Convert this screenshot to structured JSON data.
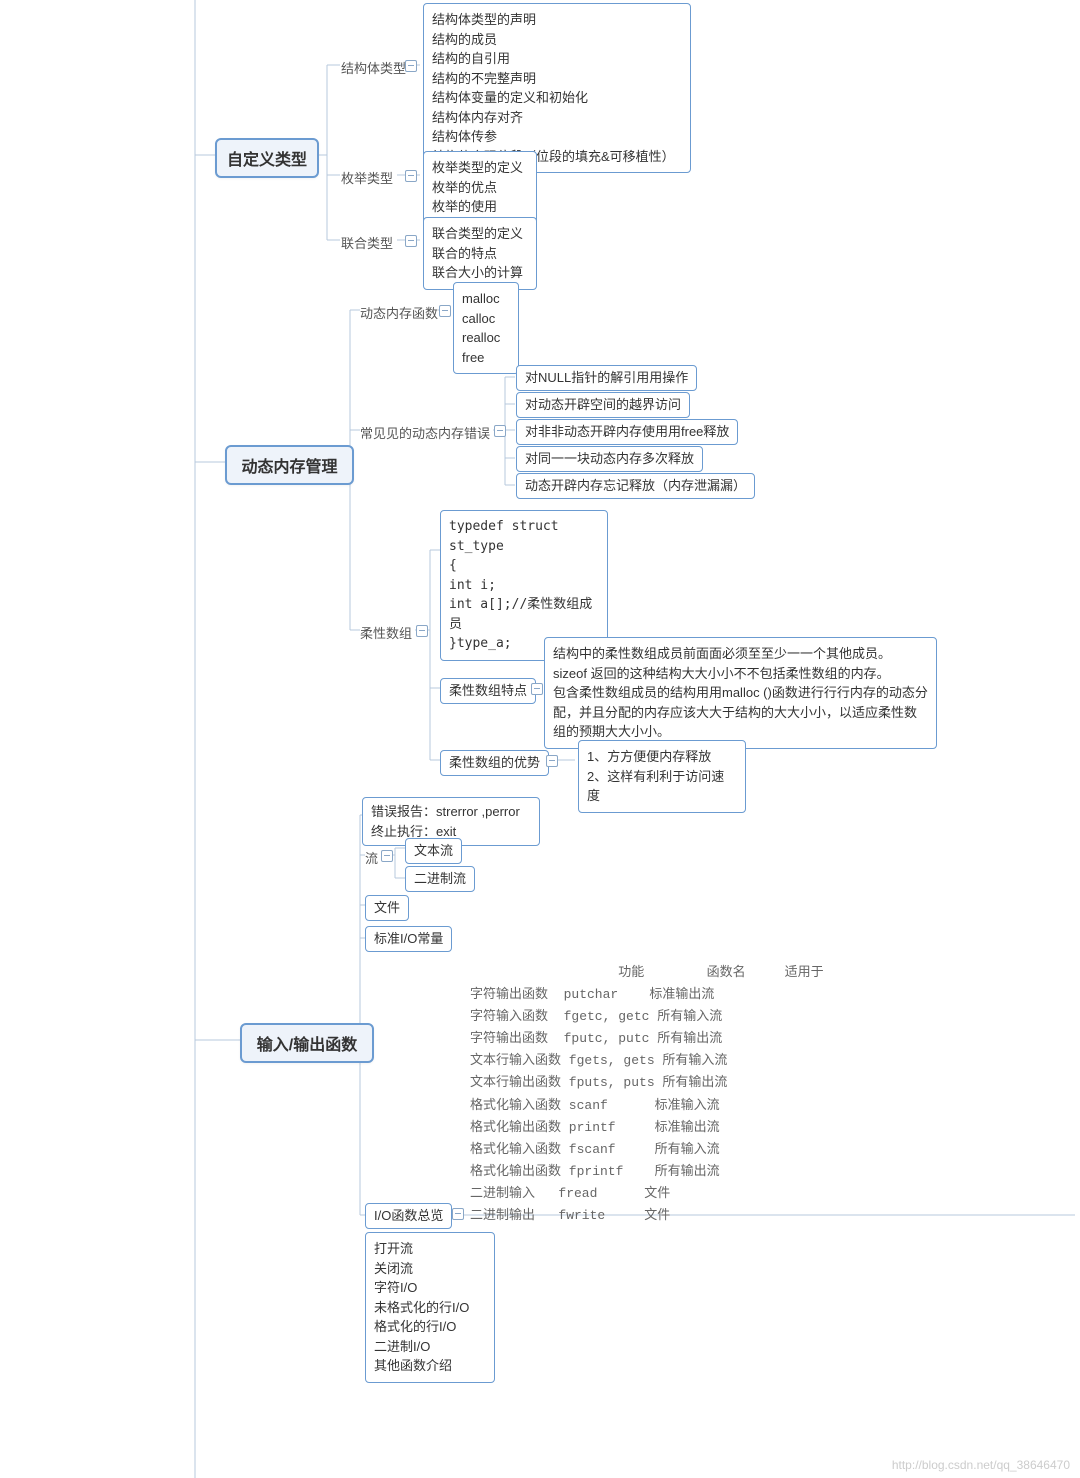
{
  "watermark": "http://blog.csdn.net/qq_38646470",
  "root1": {
    "label": "自定义类型"
  },
  "r1_struct": {
    "label": "结构体类型",
    "items": "结构体类型的声明\n结构的成员\n结构的自引用\n结构的不完整声明\n结构体变量的定义和初始化\n结构体内存对齐\n结构体传参\n结构体实现位段（位段的填充&可移植性）"
  },
  "r1_enum": {
    "label": "枚举类型",
    "items": "枚举类型的定义\n枚举的优点\n枚举的使用"
  },
  "r1_union": {
    "label": "联合类型",
    "items": "联合类型的定义\n联合的特点\n联合大小的计算"
  },
  "root2": {
    "label": "动态内存管理"
  },
  "r2_funcs": {
    "label": "动态内存函数",
    "items": "malloc\ncalloc\nrealloc\nfree"
  },
  "r2_errors": {
    "label": "常见见的动态内存错误",
    "e1": "对NULL指针的解引用用操作",
    "e2": "对动态开辟空间的越界访问",
    "e3": "对非非动态开辟内存使用用free释放",
    "e4": "对同一一块动态内存多次释放",
    "e5": "动态开辟内存忘记释放（内存泄漏漏）"
  },
  "r2_flex": {
    "label": "柔性数组",
    "code": "typedef struct st_type\n{\nint i;\nint a[];//柔性数组成员\n}type_a;",
    "prop_label": "柔性数组特点",
    "prop_text": "结构中的柔性数组成员前面面必须至至少一一个其他成员。\nsizeof 返回的这种结构大大小小不不包括柔性数组的内存。\n包含柔性数组成员的结构用用malloc ()函数进行行行内存的动态分配，并且分配的内存应该大大于结构的大大小小，以适应柔性数组的预期大大小小。",
    "adv_label": "柔性数组的优势",
    "adv_text": "1、方方便便内存释放\n2、这样有利利于访问速度"
  },
  "root3": {
    "label": "输入/输出函数"
  },
  "r3_err": {
    "text": "错误报告：strerror ,perror\n终止执行：exit"
  },
  "r3_stream": {
    "label": "流",
    "s1": "文本流",
    "s2": "二进制流"
  },
  "r3_file": {
    "label": "文件"
  },
  "r3_const": {
    "label": "标准I/O常量"
  },
  "r3_overview": {
    "label": "I/O函数总览",
    "items": "打开流\n关闭流\n字符I/O\n未格式化的行I/O\n格式化的行I/O\n二进制I/O\n其他函数介绍"
  },
  "r3_table": "                   功能        函数名     适用于\n字符输出函数  putchar    标准输出流\n字符输入函数  fgetc, getc 所有输入流\n字符输出函数  fputc, putc 所有输出流\n文本行输入函数 fgets, gets 所有输入流\n文本行输出函数 fputs, puts 所有输出流\n格式化输入函数 scanf      标准输入流\n格式化输出函数 printf     标准输出流\n格式化输入函数 fscanf     所有输入流\n格式化输出函数 fprintf    所有输出流\n二进制输入   fread      文件\n二进制输出   fwrite     文件"
}
